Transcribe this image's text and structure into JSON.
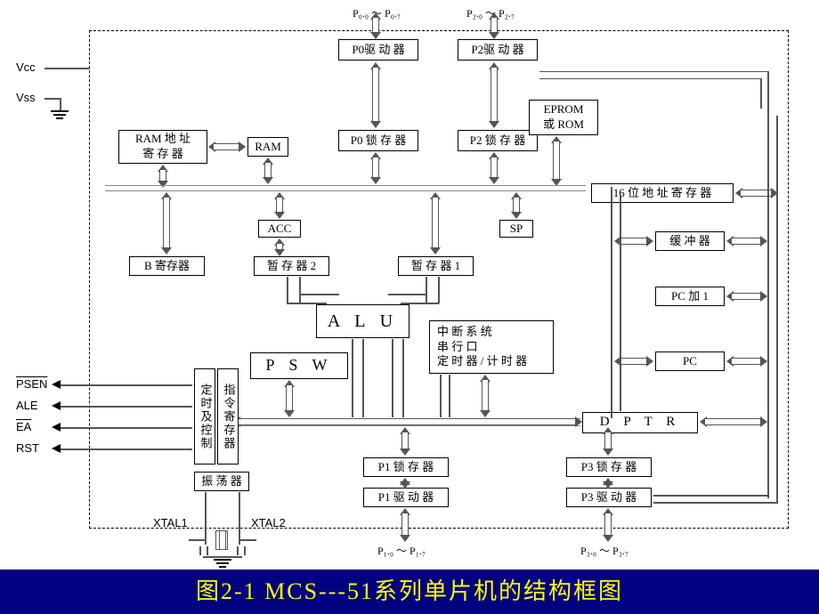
{
  "caption": "图2-1   MCS---51系列单片机的结构框图",
  "power": {
    "vcc": "Vcc",
    "vss": "Vss"
  },
  "ports": {
    "p0range": "P₀.₀ ～  P₀.₇",
    "p2range": "P₂.₀ ～  P₂.₇",
    "p1range": "P₁.₀ ～  P₁.₇",
    "p3range": "P₃.₀ ～  P₃.₇"
  },
  "blocks": {
    "p0drv": "P0驱 动 器",
    "p2drv": "P2驱 动 器",
    "p0latch": "P0 锁 存 器",
    "p2latch": "P2 锁 存 器",
    "ramaddr": "RAM 地 址\n寄 存 器",
    "ram": "RAM",
    "eprom": "EPROM\n或 ROM",
    "addr16": "16 位 地 址 寄 存 器",
    "acc": "ACC",
    "sp": "SP",
    "breg": "B 寄存器",
    "tmp2": "暂 存 器 2",
    "tmp1": "暂 存 器 1",
    "alu": "A L U",
    "psw": "P S W",
    "buffer": "缓 冲 器",
    "pcinc": "PC 加 1",
    "pc": "PC",
    "dptr": "D P T R",
    "intsys": "中 断 系 统\n串 行 口\n定 时 器 / 计 时 器",
    "p1latch": "P1 锁 存 器",
    "p1drv": "P1 驱 动 器",
    "p3latch": "P3 锁 存 器",
    "p3drv": "P3 驱 动 器",
    "timing": "定时及控制",
    "ir": "指令寄存器",
    "osc": "振 荡 器"
  },
  "signals": {
    "psen": "PSEN",
    "ale": "ALE",
    "ea": "EA",
    "rst": "RST",
    "xtal1": "XTAL1",
    "xtal2": "XTAL2"
  }
}
